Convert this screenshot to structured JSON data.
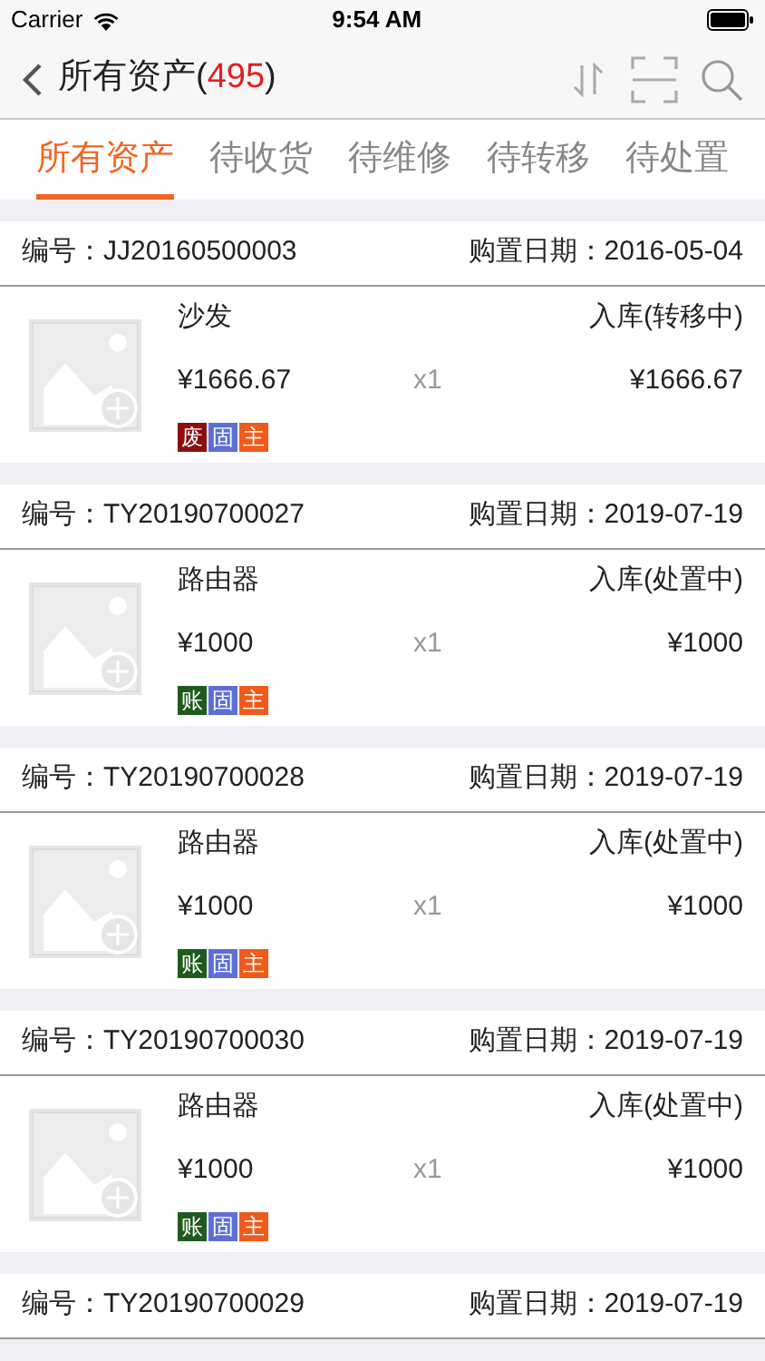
{
  "status_bar": {
    "carrier": "Carrier",
    "time": "9:54 AM"
  },
  "nav": {
    "title": "所有资产(",
    "count": "495",
    "title_end": ")"
  },
  "tabs": [
    {
      "label": "所有资产",
      "selected": true
    },
    {
      "label": "待收货",
      "selected": false
    },
    {
      "label": "待维修",
      "selected": false
    },
    {
      "label": "待转移",
      "selected": false
    },
    {
      "label": "待处置",
      "selected": false
    }
  ],
  "assets": [
    {
      "code": "编号：JJ20160500003",
      "date": "购置日期：2016-05-04",
      "name": "沙发",
      "status": "入库(转移中)",
      "price": "¥1666.67",
      "qty": "x1",
      "total": "¥1666.67",
      "tags": [
        {
          "label": "废",
          "color": "#8b0f0f"
        },
        {
          "label": "固",
          "color": "#5b6fd6"
        },
        {
          "label": "主",
          "color": "#f05a1a"
        }
      ]
    },
    {
      "code": "编号：TY20190700027",
      "date": "购置日期：2019-07-19",
      "name": "路由器",
      "status": "入库(处置中)",
      "price": "¥1000",
      "qty": "x1",
      "total": "¥1000",
      "tags": [
        {
          "label": "账",
          "color": "#1f5a1f"
        },
        {
          "label": "固",
          "color": "#5b6fd6"
        },
        {
          "label": "主",
          "color": "#f05a1a"
        }
      ]
    },
    {
      "code": "编号：TY20190700028",
      "date": "购置日期：2019-07-19",
      "name": "路由器",
      "status": "入库(处置中)",
      "price": "¥1000",
      "qty": "x1",
      "total": "¥1000",
      "tags": [
        {
          "label": "账",
          "color": "#1f5a1f"
        },
        {
          "label": "固",
          "color": "#5b6fd6"
        },
        {
          "label": "主",
          "color": "#f05a1a"
        }
      ]
    },
    {
      "code": "编号：TY20190700030",
      "date": "购置日期：2019-07-19",
      "name": "路由器",
      "status": "入库(处置中)",
      "price": "¥1000",
      "qty": "x1",
      "total": "¥1000",
      "tags": [
        {
          "label": "账",
          "color": "#1f5a1f"
        },
        {
          "label": "固",
          "color": "#5b6fd6"
        },
        {
          "label": "主",
          "color": "#f05a1a"
        }
      ]
    },
    {
      "code": "编号：TY20190700029",
      "date": "购置日期：2019-07-19"
    }
  ]
}
